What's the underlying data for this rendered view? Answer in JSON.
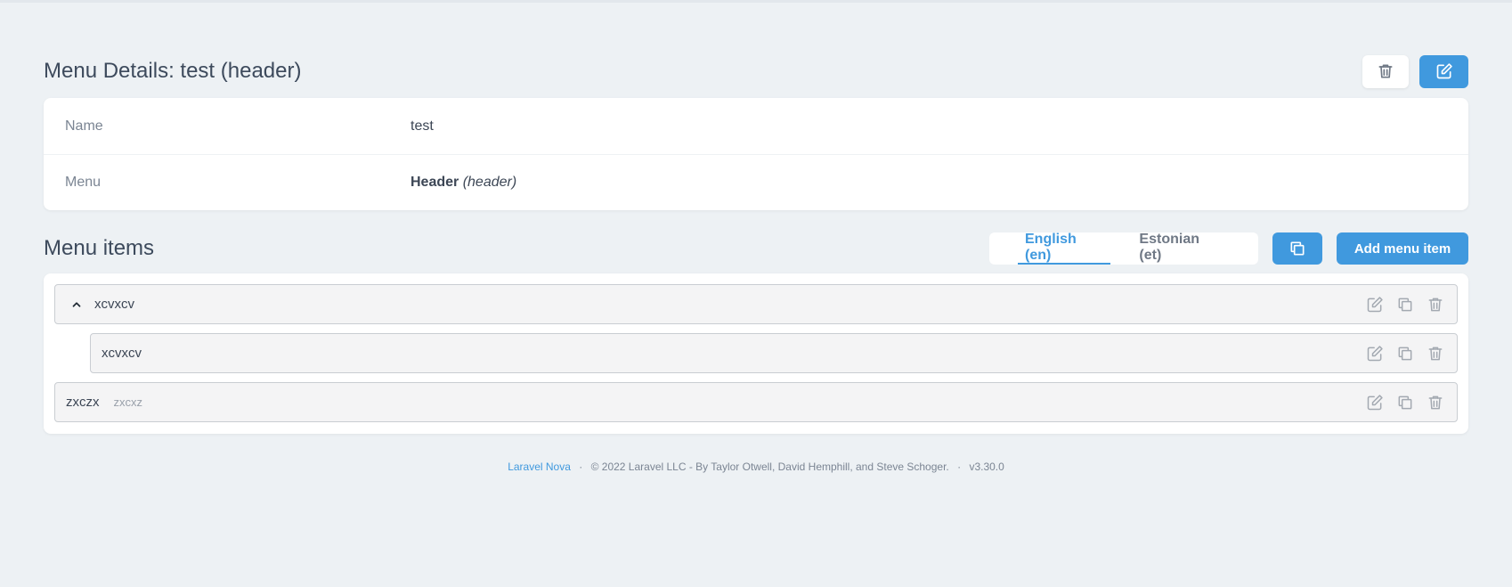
{
  "details": {
    "title": "Menu Details: test (header)",
    "rows": [
      {
        "label": "Name",
        "value": "test"
      },
      {
        "label": "Menu",
        "value_bold": "Header",
        "value_italic": "(header)"
      }
    ]
  },
  "items_section": {
    "title": "Menu items",
    "tabs": [
      "English (en)",
      "Estonian (et)"
    ],
    "active_tab": "English (en)",
    "add_label": "Add menu item"
  },
  "menu_items": [
    {
      "name": "xcvxcv",
      "sub": "",
      "expanded": true,
      "level": 0
    },
    {
      "name": "xcvxcv",
      "sub": "",
      "level": 1
    },
    {
      "name": "zxczx",
      "sub": "zxcxz",
      "level": 0
    }
  ],
  "footer": {
    "link": "Laravel Nova",
    "text": "© 2022 Laravel LLC - By Taylor Otwell, David Hemphill, and Steve Schoger.",
    "version": "v3.30.0"
  },
  "colors": {
    "accent": "#4099de",
    "background": "#edf1f4",
    "item_bg": "#f4f4f5"
  }
}
